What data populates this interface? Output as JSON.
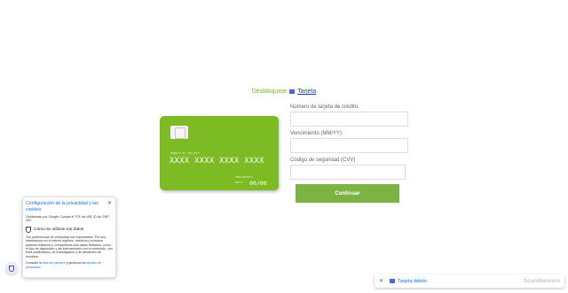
{
  "heading": {
    "prefix": "Desbloquear",
    "link_label": "Tarjeta"
  },
  "card": {
    "number_label": "Número de tarjeta",
    "number": "XXXX XXXX XXXX XXXX",
    "exp_label": "VENCIMIENTO",
    "exp_small": "MM/YY",
    "exp_value": "00/00",
    "color": "#7cbb23"
  },
  "form": {
    "card_number_label": "Número de tarjeta de crédito:",
    "expiry_label": "Vencimiento (MM/YY)",
    "cvv_label": "Código de seguridad (CVV)",
    "submit_label": "Continuar"
  },
  "privacy": {
    "title": "Configuración de la privacidad y las cookies",
    "managed_by": "Gestionado por Google Cumple el TCF de IAB. ID de CMP: 300",
    "subheading": "Cómo se utilizan tus datos",
    "body": "Tus preferencias de privacidad son importantes. Por eso, basándonos en el interés legítimo, nosotros y nuestros partners tratamos y compartimos solo datos limitados, como el tipo de dispositivo y las interacciones con el contenido, con fines publicitarios, de investigación y de desarrollo de servicios.",
    "footer_prefix": "Consulta la",
    "footer_link1": "lista de partners",
    "footer_mid": "y gestiona los",
    "footer_link2": "ajustes de privacidad",
    "footer_suffix": "."
  },
  "bottom_bar": {
    "tab_label": "Tarjeta débito",
    "brand": "ScanMalware"
  },
  "colors": {
    "accent": "#7cb342",
    "link": "#1a73e8"
  }
}
